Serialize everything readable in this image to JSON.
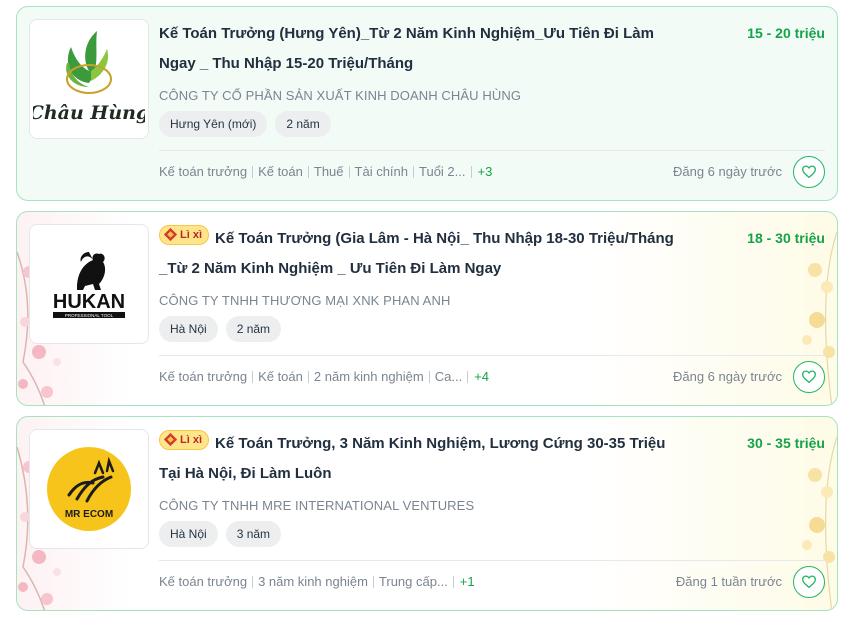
{
  "jobs": [
    {
      "title": "Kế Toán Trưởng (Hưng Yên)_Từ 2 Năm Kinh Nghiệm_Ưu Tiên Đi Làm Ngay _ Thu Nhập 15-20 Triệu/Tháng",
      "badge": "",
      "salary": "15 - 20 triệu",
      "company": "CÔNG TY CỔ PHẦN SẢN XUẤT KINH DOANH CHÂU HÙNG",
      "logo_text": "Châu Hùng",
      "tags": [
        "Hưng Yên (mới)",
        "2 năm"
      ],
      "skills": [
        "Kế toán trưởng",
        "Kế toán",
        "Thuế",
        "Tài chính",
        "Tuổi 2..."
      ],
      "more": "+3",
      "posted": "Đăng 6 ngày trước"
    },
    {
      "title": "Kế Toán Trưởng (Gia Lâm - Hà Nội_ Thu Nhập 18-30 Triệu/Tháng _Từ 2 Năm Kinh Nghiệm _ Ưu Tiên Đi Làm Ngay",
      "badge": "Lì xì",
      "salary": "18 - 30 triệu",
      "company": "CÔNG TY TNHH THƯƠNG MẠI XNK PHAN ANH",
      "logo_text": "HUKAN",
      "logo_sub": "PROFESSIONAL TOOL",
      "tags": [
        "Hà Nội",
        "2 năm"
      ],
      "skills": [
        "Kế toán trưởng",
        "Kế toán",
        "2 năm kinh nghiệm",
        "Ca..."
      ],
      "more": "+4",
      "posted": "Đăng 6 ngày trước"
    },
    {
      "title": "Kế Toán Trưởng, 3 Năm Kinh Nghiệm, Lương Cứng 30-35 Triệu Tại Hà Nội, Đi Làm Luôn",
      "badge": "Lì xì",
      "salary": "30 - 35 triệu",
      "company": "CÔNG TY TNHH MRE INTERNATIONAL VENTURES",
      "logo_text": "MR ECOM",
      "tags": [
        "Hà Nội",
        "3 năm"
      ],
      "skills": [
        "Kế toán trưởng",
        "3 năm kinh nghiệm",
        "Trung cấp..."
      ],
      "more": "+1",
      "posted": "Đăng 1 tuần trước"
    }
  ],
  "icons": {
    "heart": "heart-icon",
    "gift": "gift-icon"
  },
  "colors": {
    "accent": "#15a34a",
    "border": "#a6e3bf",
    "badge_bg": "#fde68a",
    "badge_text": "#c02626"
  }
}
